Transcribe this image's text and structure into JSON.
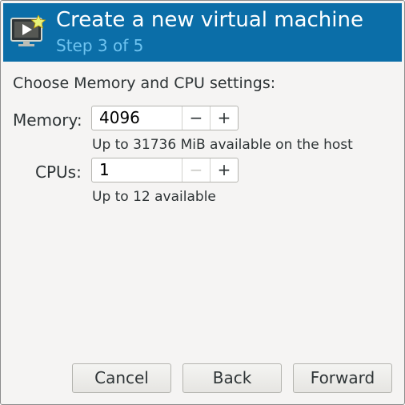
{
  "header": {
    "title": "Create a new virtual machine",
    "subtitle": "Step 3 of 5",
    "icon": "vm-monitor-new-icon",
    "background": "#0b6ea8",
    "subtitle_color": "#6ec3f0"
  },
  "section_title": "Choose Memory and CPU settings:",
  "memory": {
    "label": "Memory:",
    "value": "4096",
    "decrement": "−",
    "increment": "+",
    "hint": "Up to 31736 MiB available on the host"
  },
  "cpus": {
    "label": "CPUs:",
    "value": "1",
    "decrement": "−",
    "increment": "+",
    "hint": "Up to 12 available"
  },
  "buttons": {
    "cancel": "Cancel",
    "back": "Back",
    "forward": "Forward"
  }
}
